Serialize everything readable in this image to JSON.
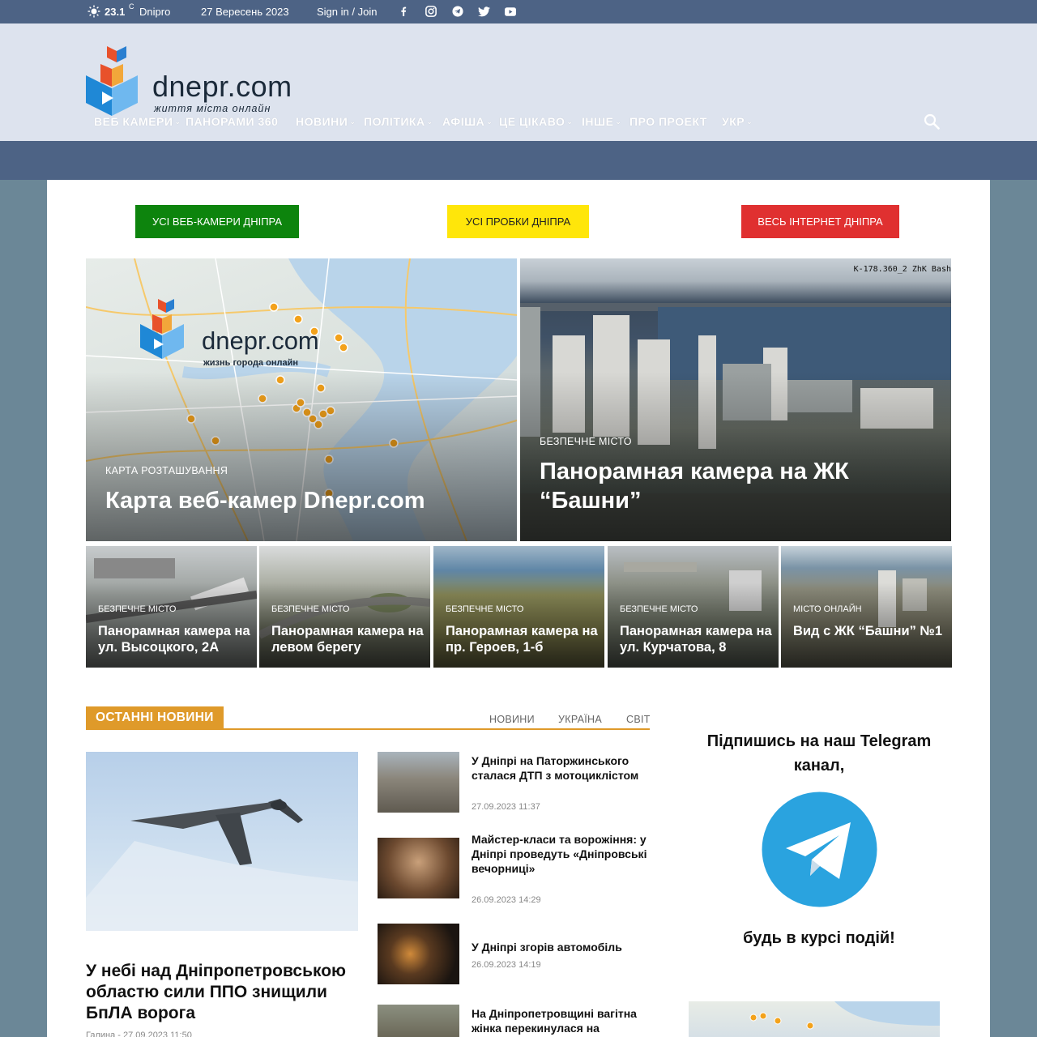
{
  "topbar": {
    "temperature": "23.1",
    "unit": "C",
    "city": "Dnipro",
    "date": "27 Вересень 2023",
    "sign_in": "Sign in / Join",
    "social_icons": [
      "facebook-icon",
      "instagram-icon",
      "telegram-icon",
      "twitter-icon",
      "youtube-icon"
    ]
  },
  "logo": {
    "name": "dnepr.com",
    "tagline": "життя міста онлайн"
  },
  "nav": [
    {
      "label": "ВЕБ КАМЕРИ",
      "dropdown": true
    },
    {
      "label": "ПАНОРАМИ 360",
      "dropdown": false
    },
    {
      "label": "НОВИНИ",
      "dropdown": true
    },
    {
      "label": "ПОЛІТИКА",
      "dropdown": true
    },
    {
      "label": "АФІША",
      "dropdown": true
    },
    {
      "label": "ЦЕ ЦІКАВО",
      "dropdown": true
    },
    {
      "label": "ІНШЕ",
      "dropdown": true
    },
    {
      "label": "ПРО ПРОЕКТ",
      "dropdown": false
    },
    {
      "label": "УКР",
      "dropdown": true
    }
  ],
  "buttons": {
    "webcams": "УСІ ВЕБ-КАМЕРИ ДНІПРА",
    "traffic": "УСІ ПРОБКИ ДНІПРА",
    "internet": "ВЕСЬ ІНТЕРНЕТ ДНІПРА"
  },
  "colors": {
    "topbar": "#4d6385",
    "accent": "#df9a2a",
    "btn_green": "#0d840d",
    "btn_yellow": "#ffe60a",
    "btn_red": "#e03030",
    "telegram": "#2aa3df"
  },
  "featured": [
    {
      "category": "КАРТА РОЗТАШУВАННЯ",
      "title": "Карта веб-камер Dnepr.com",
      "image_logo_text": "dnepr.com",
      "image_logo_sub": "жизнь города онлайн"
    },
    {
      "category": "БЕЗПЕЧНЕ МІСТО",
      "title": "Панорамная камера на ЖК “Башни”",
      "cam_tag": "K-178.360_2 ZhK Bash"
    }
  ],
  "tiles": [
    {
      "category": "БЕЗПЕЧНЕ МІСТО",
      "title": "Панорамная камера на ул. Высоцкого, 2А"
    },
    {
      "category": "БЕЗПЕЧНЕ МІСТО",
      "title": "Панорамная камера на левом берегу"
    },
    {
      "category": "БЕЗПЕЧНЕ МІСТО",
      "title": "Панорамная камера на пр. Героев, 1-б"
    },
    {
      "category": "БЕЗПЕЧНЕ МІСТО",
      "title": "Панорамная камера на ул. Курчатова, 8"
    },
    {
      "category": "МІСТО ОНЛАЙН",
      "title": "Вид с ЖК “Башни” №1"
    }
  ],
  "latest": {
    "heading": "ОСТАННІ НОВИНИ",
    "tabs": [
      "НОВИНИ",
      "УКРАЇНА",
      "СВІТ"
    ],
    "lead": {
      "title": "У небі над Дніпропетровською областю сили ППО знищили БпЛА ворога",
      "meta": "Галина - 27.09.2023 11:50"
    },
    "items": [
      {
        "title": "У Дніпрі на Паторжинського сталася ДТП з мотоциклістом",
        "date": "27.09.2023 11:37"
      },
      {
        "title": "Майстер-класи та ворожіння: у Дніпрі проведуть «Дніпровські вечорниці»",
        "date": "26.09.2023 14:29"
      },
      {
        "title": "У Дніпрі згорів автомобіль",
        "date": "26.09.2023 14:19"
      },
      {
        "title": "На Дніпропетровщині вагітна жінка перекинулася на",
        "date": ""
      }
    ]
  },
  "sidebar": {
    "telegram_title": "Підпишись на наш Telegram канал,",
    "telegram_sub": "будь в курсі подій!"
  }
}
